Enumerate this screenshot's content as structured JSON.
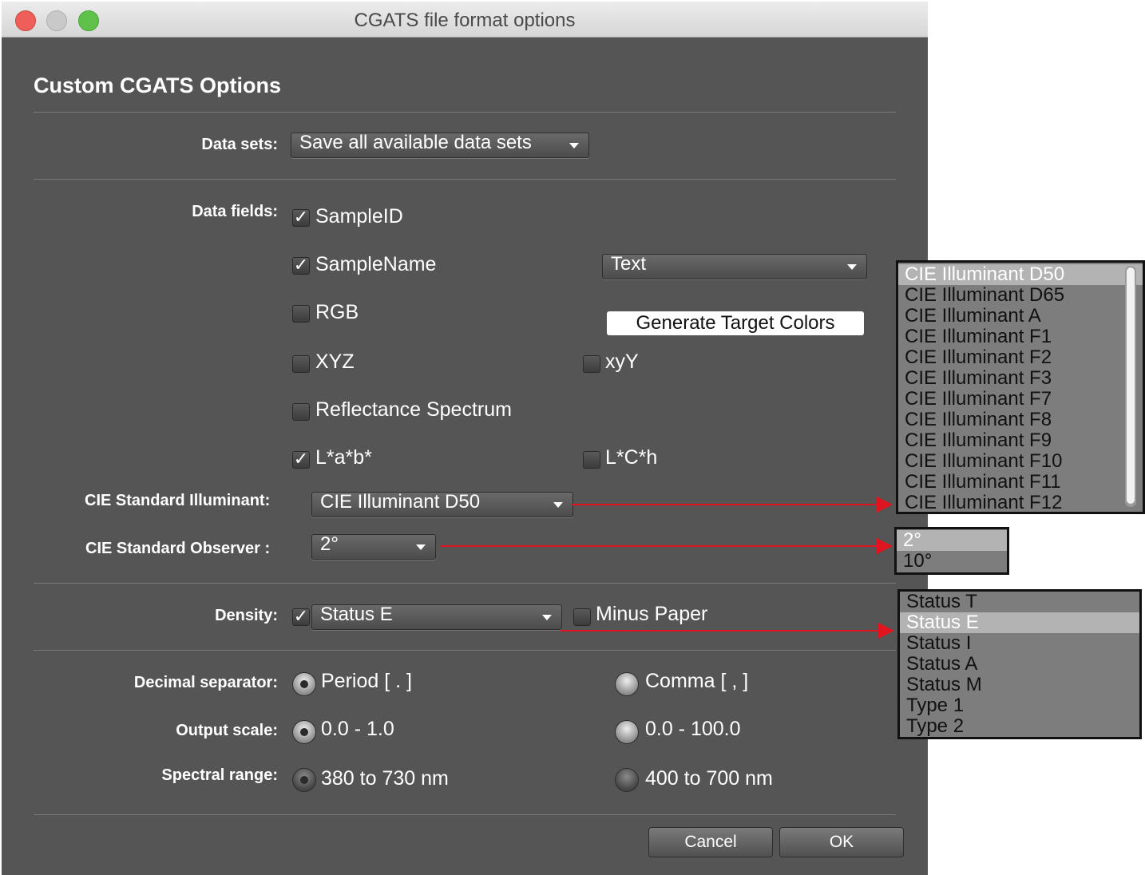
{
  "window": {
    "title": "CGATS file format options"
  },
  "heading": "Custom CGATS Options",
  "data_sets": {
    "label": "Data sets:",
    "value": "Save all available data sets"
  },
  "data_fields": {
    "label": "Data fields:",
    "sample_id": {
      "label": "SampleID",
      "checked": true
    },
    "sample_name": {
      "label": "SampleName",
      "checked": true
    },
    "sample_name_type": "Text",
    "rgb": {
      "label": "RGB",
      "checked": false
    },
    "generate_button": "Generate Target Colors",
    "xyz": {
      "label": "XYZ",
      "checked": false
    },
    "xyy": {
      "label": "xyY",
      "checked": false
    },
    "reflectance": {
      "label": "Reflectance Spectrum",
      "checked": false
    },
    "lab": {
      "label": "L*a*b*",
      "checked": true
    },
    "lch": {
      "label": "L*C*h",
      "checked": false
    }
  },
  "illuminant": {
    "label": "CIE Standard Illuminant:",
    "value": "CIE Illuminant D50"
  },
  "observer": {
    "label": "CIE Standard Observer :",
    "value": "2°"
  },
  "density": {
    "label": "Density:",
    "checked": true,
    "value": "Status E",
    "minus_paper": {
      "label": "Minus Paper",
      "checked": false
    }
  },
  "decimal": {
    "label": "Decimal separator:",
    "opt1": "Period [ . ]",
    "opt2": "Comma [ , ]",
    "selected": "opt1"
  },
  "output_scale": {
    "label": "Output scale:",
    "opt1": "0.0 - 1.0",
    "opt2": "0.0 - 100.0",
    "selected": "opt1"
  },
  "spectral_range": {
    "label": "Spectral range:",
    "opt1": "380 to 730 nm",
    "opt2": "400 to 700 nm",
    "selected": "opt1"
  },
  "buttons": {
    "cancel": "Cancel",
    "ok": "OK"
  },
  "illuminant_list": [
    "CIE Illuminant D50",
    "CIE Illuminant D65",
    "CIE Illuminant A",
    "CIE Illuminant F1",
    "CIE Illuminant F2",
    "CIE Illuminant F3",
    "CIE Illuminant F7",
    "CIE Illuminant F8",
    "CIE Illuminant F9",
    "CIE Illuminant F10",
    "CIE Illuminant F11",
    "CIE Illuminant F12"
  ],
  "observer_list": [
    "2°",
    "10°"
  ],
  "density_list": [
    "Status T",
    "Status E",
    "Status I",
    "Status A",
    "Status M",
    "Type 1",
    "Type 2"
  ],
  "colors": {
    "window_bg": "#555555",
    "arrow": "#e0141e",
    "traffic_close": "#ee5f5a",
    "traffic_min": "#c9c9c9",
    "traffic_max": "#5fc14a"
  }
}
